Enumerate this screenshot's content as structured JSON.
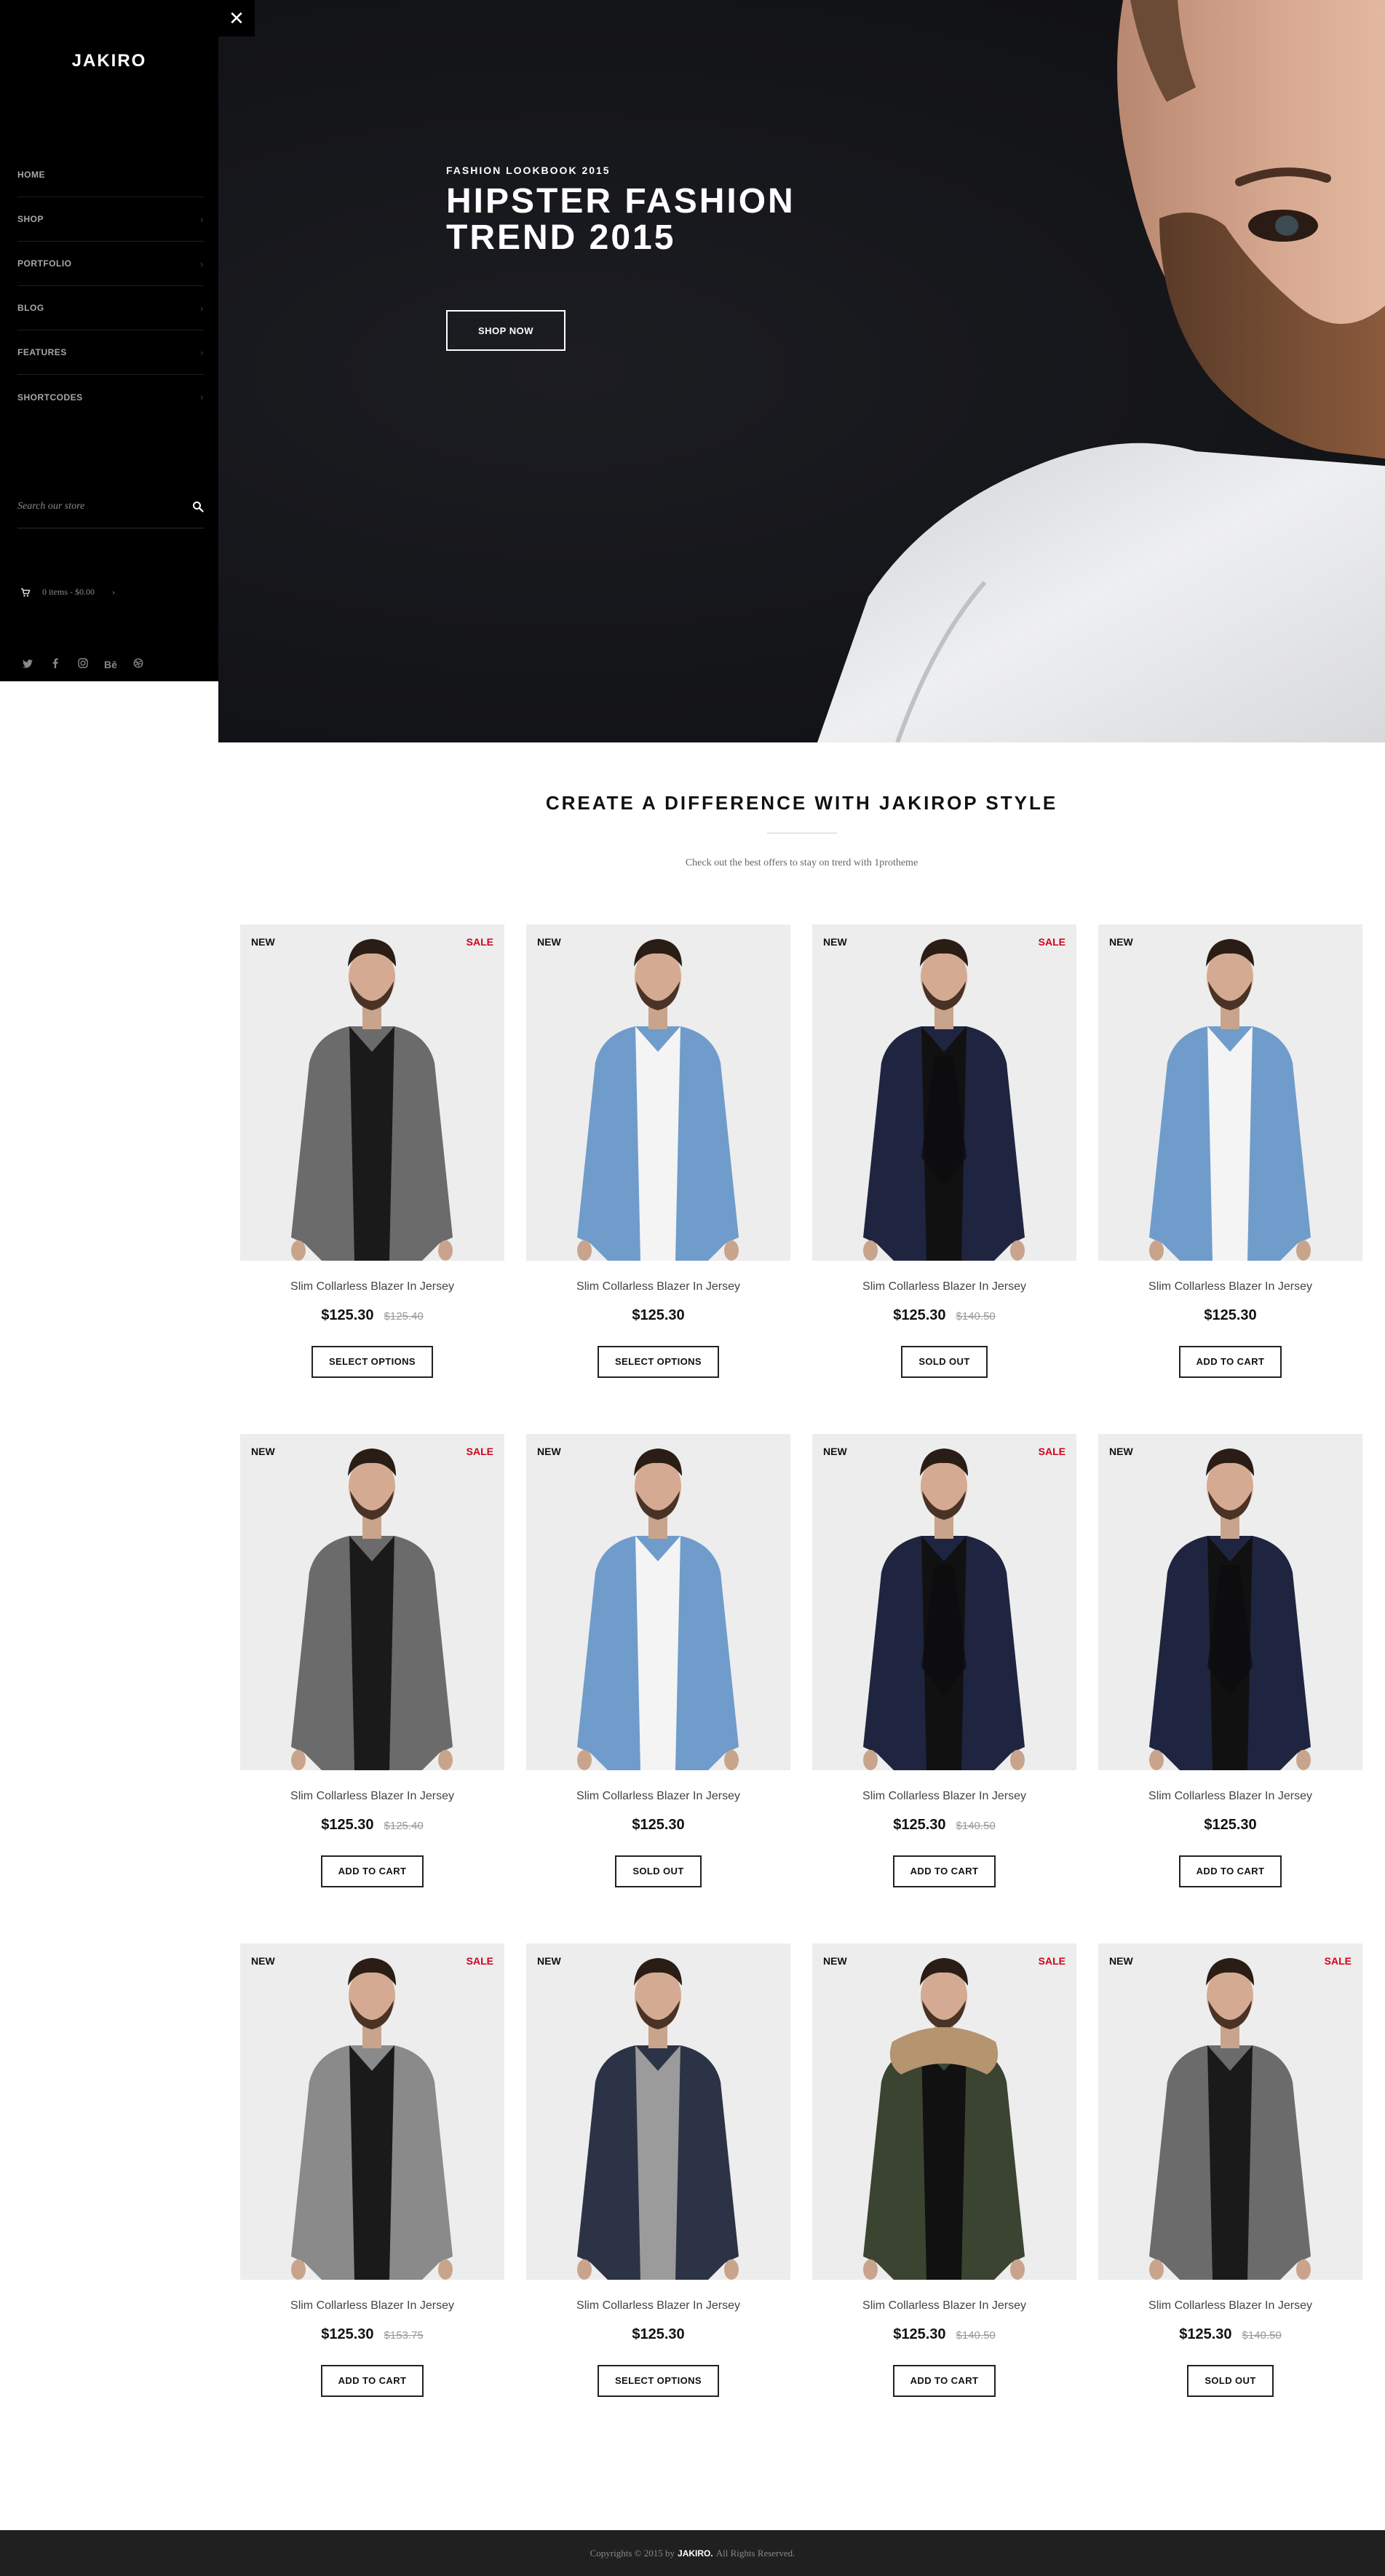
{
  "sidebar": {
    "logo": "JAKIRO",
    "nav": [
      {
        "label": "HOME",
        "has_children": false
      },
      {
        "label": "SHOP",
        "has_children": true
      },
      {
        "label": "PORTFOLIO",
        "has_children": true
      },
      {
        "label": "BLOG",
        "has_children": true
      },
      {
        "label": "FEATURES",
        "has_children": true
      },
      {
        "label": "SHORTCODES",
        "has_children": true
      }
    ],
    "search_placeholder": "Search our store",
    "cart_text": "0 items - $0.00",
    "social": [
      "twitter-icon",
      "facebook-icon",
      "instagram-icon",
      "behance-icon",
      "dribbble-icon"
    ]
  },
  "hero": {
    "subtitle": "FASHION LOOKBOOK 2015",
    "title_line1": "HIPSTER FASHION",
    "title_line2": "TREND 2015",
    "button": "SHOP NOW"
  },
  "section": {
    "title": "CREATE A DIFFERENCE WITH JAKIROP STYLE",
    "description": "Check out the best offers to stay on trerd with 1protheme"
  },
  "products": [
    {
      "name": "Slim Collarless Blazer In Jersey",
      "price": "$125.30",
      "old_price": "$125.40",
      "new": "NEW",
      "sale": "SALE",
      "button": "SELECT OPTIONS",
      "style": "grey-blazer"
    },
    {
      "name": "Slim Collarless Blazer In Jersey",
      "price": "$125.30",
      "old_price": "",
      "new": "NEW",
      "sale": "",
      "button": "SELECT OPTIONS",
      "style": "denim-kimono"
    },
    {
      "name": "Slim Collarless Blazer In Jersey",
      "price": "$125.30",
      "old_price": "$140.50",
      "new": "NEW",
      "sale": "SALE",
      "button": "SOLD OUT",
      "style": "navy-tuxedo"
    },
    {
      "name": "Slim Collarless Blazer In Jersey",
      "price": "$125.30",
      "old_price": "",
      "new": "NEW",
      "sale": "",
      "button": "ADD TO CART",
      "style": "denim-kimono"
    },
    {
      "name": "Slim Collarless Blazer In Jersey",
      "price": "$125.30",
      "old_price": "$125.40",
      "new": "NEW",
      "sale": "SALE",
      "button": "ADD TO CART",
      "style": "grey-blazer"
    },
    {
      "name": "Slim Collarless Blazer In Jersey",
      "price": "$125.30",
      "old_price": "",
      "new": "NEW",
      "sale": "",
      "button": "SOLD OUT",
      "style": "denim-kimono"
    },
    {
      "name": "Slim Collarless Blazer In Jersey",
      "price": "$125.30",
      "old_price": "$140.50",
      "new": "NEW",
      "sale": "SALE",
      "button": "ADD TO CART",
      "style": "navy-tuxedo"
    },
    {
      "name": "Slim Collarless Blazer In Jersey",
      "price": "$125.30",
      "old_price": "",
      "new": "NEW",
      "sale": "",
      "button": "ADD TO CART",
      "style": "navy-tuxedo"
    },
    {
      "name": "Slim Collarless Blazer In Jersey",
      "price": "$125.30",
      "old_price": "$153.75",
      "new": "NEW",
      "sale": "SALE",
      "button": "ADD TO CART",
      "style": "grey-coat"
    },
    {
      "name": "Slim Collarless Blazer In Jersey",
      "price": "$125.30",
      "old_price": "",
      "new": "NEW",
      "sale": "",
      "button": "SELECT OPTIONS",
      "style": "navy-sweater"
    },
    {
      "name": "Slim Collarless Blazer In Jersey",
      "price": "$125.30",
      "old_price": "$140.50",
      "new": "NEW",
      "sale": "SALE",
      "button": "ADD TO CART",
      "style": "green-parka"
    },
    {
      "name": "Slim Collarless Blazer In Jersey",
      "price": "$125.30",
      "old_price": "$140.50",
      "new": "NEW",
      "sale": "SALE",
      "button": "SOLD OUT",
      "style": "grey-blazer"
    }
  ],
  "colors": {
    "grey-blazer": "#6b6b6b",
    "denim-kimono": "#6f9ccb",
    "navy-tuxedo": "#1f2540",
    "grey-coat": "#8a8a8a",
    "navy-sweater": "#2c3346",
    "green-parka": "#3b4430",
    "sale": "#d0021b"
  },
  "footer": {
    "before": "Copyrights © 2015 by",
    "brand": "JAKIRO.",
    "after": "All Rights Reserved."
  }
}
